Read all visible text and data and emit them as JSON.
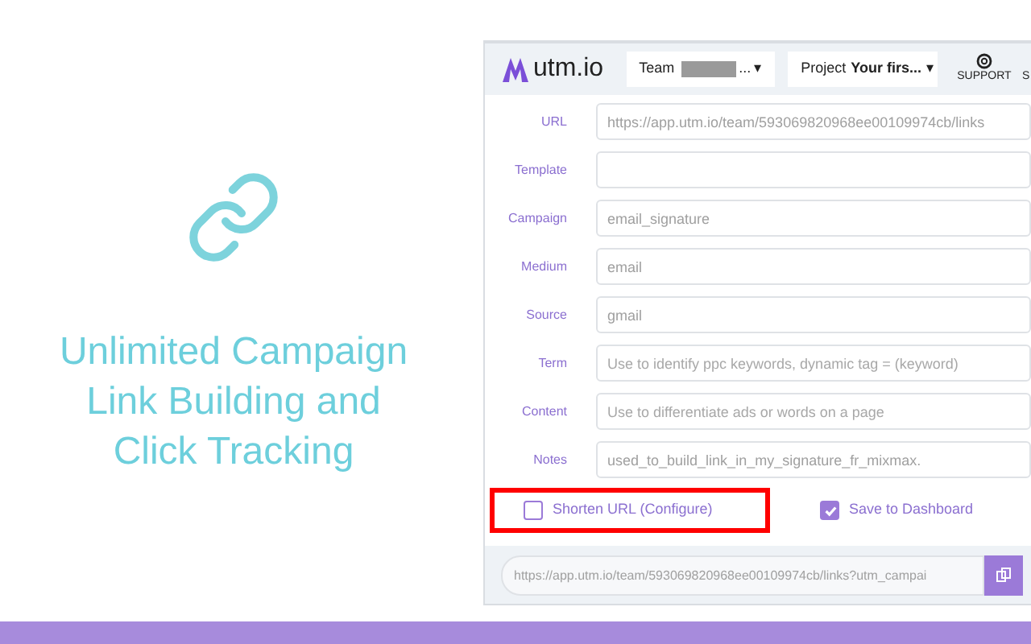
{
  "promo": {
    "headline": "Unlimited Campaign Link Building and Click Tracking"
  },
  "header": {
    "logo": "utm.io",
    "team": {
      "label": "Team",
      "suffix": "...",
      "caret": "▾"
    },
    "project": {
      "label": "Project",
      "name": "Your firs...",
      "caret": "▾"
    },
    "nav": [
      {
        "label": "SUPPORT"
      },
      {
        "label": "S"
      }
    ]
  },
  "fields": [
    {
      "label": "URL",
      "value": "https://app.utm.io/team/593069820968ee00109974cb/links"
    },
    {
      "label": "Template"
    },
    {
      "label": "Campaign",
      "value": "email_signature"
    },
    {
      "label": "Medium",
      "value": "email"
    },
    {
      "label": "Source",
      "value": "gmail"
    },
    {
      "label": "Term",
      "placeholder": "Use to identify ppc keywords, dynamic tag = (keyword)"
    },
    {
      "label": "Content",
      "placeholder": "Use to differentiate ads or words on a page"
    },
    {
      "label": "Notes",
      "value": "used_to_build_link_in_my_signature_fr_mixmax."
    }
  ],
  "options": [
    {
      "label": "Shorten URL (Configure)",
      "checked": false,
      "highlighted": true
    },
    {
      "label": "Save to Dashboard",
      "checked": true,
      "highlighted": false
    }
  ],
  "result": {
    "value": "https://app.utm.io/team/593069820968ee00109974cb/links?utm_campai"
  }
}
